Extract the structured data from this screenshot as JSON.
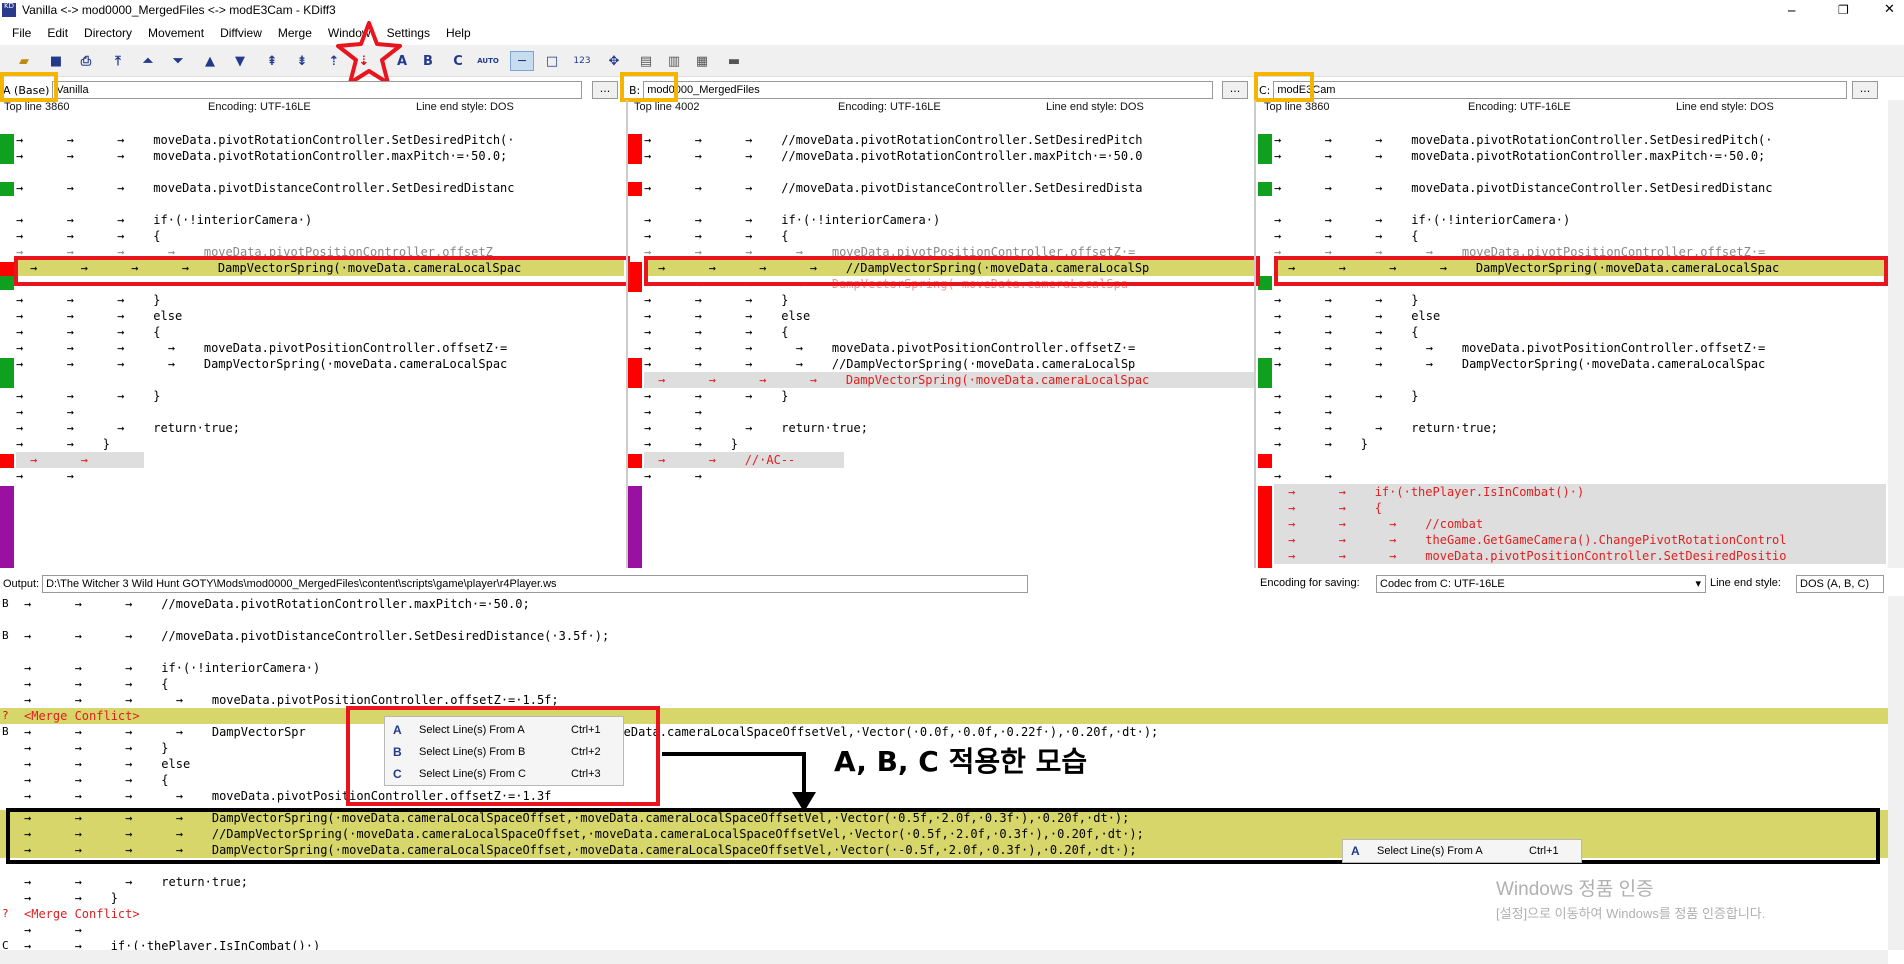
{
  "window": {
    "title": "Vanilla <-> mod0000_MergedFiles <-> modE3Cam - KDiff3"
  },
  "menu": [
    "File",
    "Edit",
    "Directory",
    "Movement",
    "Diffview",
    "Merge",
    "Window",
    "Settings",
    "Help"
  ],
  "toolbar": {
    "auto_label": "AUTO",
    "num_label": "123",
    "b_label": "B",
    "c_label": "C"
  },
  "panes": [
    {
      "label": "A (Base)",
      "file": "Vanilla",
      "top_line": "Top line 3860",
      "encoding": "Encoding: UTF-16LE",
      "line_end": "Line end style: DOS"
    },
    {
      "label": "B:",
      "file": "mod0000_MergedFiles",
      "top_line": "Top line 4002",
      "encoding": "Encoding: UTF-16LE",
      "line_end": "Line end style: DOS"
    },
    {
      "label": "C:",
      "file": "modE3Cam",
      "top_line": "Top line 3860",
      "encoding": "Encoding: UTF-16LE",
      "line_end": "Line end style: DOS"
    }
  ],
  "dots_label": "...",
  "pane_lines": {
    "a": [
      "→      →      →    moveData.pivotRotationController.SetDesiredPitch(·",
      "→      →      →    moveData.pivotRotationController.maxPitch·=·50.0;",
      "",
      "→      →      →    moveData.pivotDistanceController.SetDesiredDistanc",
      "",
      "→      →      →    if·(·!interiorCamera·)",
      "→      →      →    {",
      "→      →      →      →    moveData.pivotPositionController.offsetZ",
      "→      →      →      →    DampVectorSpring(·moveData.cameraLocalSpac",
      "",
      "→      →      →    }",
      "→      →      →    else",
      "→      →      →    {",
      "→      →      →      →    moveData.pivotPositionController.offsetZ·=",
      "→      →      →      →    DampVectorSpring(·moveData.cameraLocalSpac",
      "",
      "→      →      →    }",
      "→      →",
      "→      →      →    return·true;",
      "→      →    }",
      "→      →",
      "→      →"
    ],
    "b": [
      "→      →      →    //moveData.pivotRotationController.SetDesiredPitch",
      "→      →      →    //moveData.pivotRotationController.maxPitch·=·50.0",
      "",
      "→      →      →    //moveData.pivotDistanceController.SetDesiredDista",
      "",
      "→      →      →    if·(·!interiorCamera·)",
      "→      →      →    {",
      "→      →      →      →    moveData.pivotPositionController.offsetZ·=",
      "→      →      →      →    //DampVectorSpring(·moveData.cameraLocalSp",
      "→      →      →      →    DampVectorSpring(·moveData.cameraLocalSpa",
      "→      →      →    }",
      "→      →      →    else",
      "→      →      →    {",
      "→      →      →      →    moveData.pivotPositionController.offsetZ·=",
      "→      →      →      →    //DampVectorSpring(·moveData.cameraLocalSp",
      "→      →      →      →    DampVectorSpring(·moveData.cameraLocalSpac",
      "→      →      →    }",
      "→      →",
      "→      →      →    return·true;",
      "→      →    }",
      "→      →    //·AC--",
      "→      →"
    ],
    "c": [
      "→      →      →    moveData.pivotRotationController.SetDesiredPitch(·",
      "→      →      →    moveData.pivotRotationController.maxPitch·=·50.0;",
      "",
      "→      →      →    moveData.pivotDistanceController.SetDesiredDistanc",
      "",
      "→      →      →    if·(·!interiorCamera·)",
      "→      →      →    {",
      "→      →      →      →    moveData.pivotPositionController.offsetZ·=",
      "→      →      →      →    DampVectorSpring(·moveData.cameraLocalSpac",
      "",
      "→      →      →    }",
      "→      →      →    else",
      "→      →      →    {",
      "→      →      →      →    moveData.pivotPositionController.offsetZ·=",
      "→      →      →      →    DampVectorSpring(·moveData.cameraLocalSpac",
      "",
      "→      →      →    }",
      "→      →",
      "→      →      →    return·true;",
      "→      →    }",
      "",
      "→      →",
      "→      →    if·(·thePlayer.IsInCombat()·)",
      "→      →    {",
      "→      →      →    //combat",
      "→      →      →    theGame.GetGameCamera().ChangePivotRotationControl",
      "→      →      →    moveData.pivotPositionController.SetDesiredPositio"
    ]
  },
  "output": {
    "label": "Output:",
    "path": "D:\\The Witcher 3 Wild Hunt GOTY\\Mods\\mod0000_MergedFiles\\content\\scripts\\game\\player\\r4Player.ws",
    "encoding_label": "Encoding for saving:",
    "encoding_value": "Codec from C: UTF-16LE",
    "line_end_label": "Line end style:",
    "line_end_value": "DOS (A, B, C)"
  },
  "output_lines": [
    {
      "src": "B",
      "text": "→      →      →    //moveData.pivotRotationController.maxPitch·=·50.0;"
    },
    {
      "src": "",
      "text": ""
    },
    {
      "src": "B",
      "text": "→      →      →    //moveData.pivotDistanceController.SetDesiredDistance(·3.5f·);"
    },
    {
      "src": "",
      "text": ""
    },
    {
      "src": "",
      "text": "→      →      →    if·(·!interiorCamera·)"
    },
    {
      "src": "",
      "text": "→      →      →    {"
    },
    {
      "src": "",
      "text": "→      →      →      →    moveData.pivotPositionController.offsetZ·=·1.5f;"
    },
    {
      "src": "?",
      "text": "<Merge Conflict>"
    },
    {
      "src": "B",
      "text": "→      →      →      →    DampVectorSpr                                  ffset,·moveData.cameraLocalSpaceOffsetVel,·Vector(·0.0f,·0.0f,·0.22f·),·0.20f,·dt·);"
    },
    {
      "src": "",
      "text": "→      →      →    }"
    },
    {
      "src": "",
      "text": "→      →      →    else"
    },
    {
      "src": "",
      "text": "→      →      →    {"
    },
    {
      "src": "",
      "text": "→      →      →      →    moveData.pivotPositionController.offsetZ·=·1.3f"
    },
    {
      "src": "",
      "text": "→      →      →      →    DampVectorSpring(·moveData.cameraLocalSpaceOffset,·moveData.cameraLocalSpaceOffsetVel,·Vector(·0.5f,·2.0f,·0.3f·),·0.20f,·dt·);"
    },
    {
      "src": "",
      "text": "→      →      →      →    //DampVectorSpring(·moveData.cameraLocalSpaceOffset,·moveData.cameraLocalSpaceOffsetVel,·Vector(·0.5f,·2.0f,·0.3f·),·0.20f,·dt·);"
    },
    {
      "src": "",
      "text": "→      →      →      →    DampVectorSpring(·moveData.cameraLocalSpaceOffset,·moveData.cameraLocalSpaceOffsetVel,·Vector(·-0.5f,·2.0f,·0.3f·),·0.20f,·dt·);"
    },
    {
      "src": "",
      "text": ""
    },
    {
      "src": "",
      "text": "→      →      →    return·true;"
    },
    {
      "src": "",
      "text": "→      →    }"
    },
    {
      "src": "?",
      "text": "<Merge Conflict>"
    },
    {
      "src": "",
      "text": "→      →"
    },
    {
      "src": "C",
      "text": "→      →    if·(·thePlayer.IsInCombat()·)"
    }
  ],
  "context_menu": [
    {
      "icon": "A",
      "label": "Select Line(s) From A",
      "shortcut": "Ctrl+1"
    },
    {
      "icon": "B",
      "label": "Select Line(s) From B",
      "shortcut": "Ctrl+2"
    },
    {
      "icon": "C",
      "label": "Select Line(s) From C",
      "shortcut": "Ctrl+3"
    }
  ],
  "context_menu2": {
    "icon": "A",
    "label": "Select Line(s) From A",
    "shortcut": "Ctrl+1"
  },
  "annotation": "A, B, C 적용한 모습",
  "watermark": {
    "line1": "Windows 정품 인증",
    "line2": "[설정]으로 이동하여 Windows를 정품 인증합니다."
  },
  "colors": {
    "conflict_yellow": "#d6d66a",
    "marker_red": "#ff0000",
    "marker_green": "#10a020",
    "marker_purple": "#9a10a0",
    "highlight_orange": "#f5b400",
    "highlight_red": "#e8141e"
  }
}
